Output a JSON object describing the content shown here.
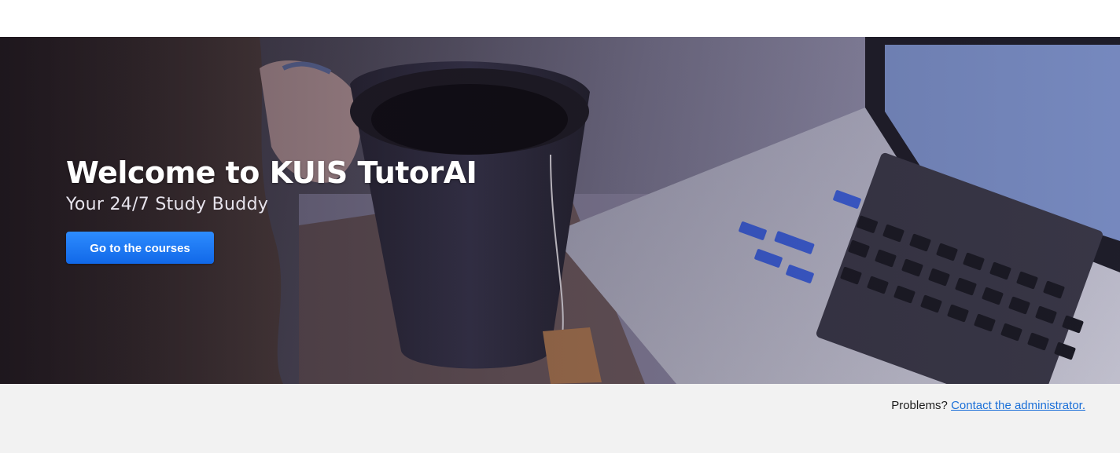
{
  "hero": {
    "title": "Welcome to KUIS TutorAI",
    "subtitle": "Your 24/7 Study Buddy",
    "cta_label": "Go to the courses",
    "image": "laptop-and-tea-mug-photo"
  },
  "footer": {
    "problems_text": "Problems?",
    "contact_link_label": "Contact the administrator."
  },
  "colors": {
    "accent": "#1a73e8",
    "footer_bg": "#f2f2f2",
    "link": "#1a6fd8"
  }
}
